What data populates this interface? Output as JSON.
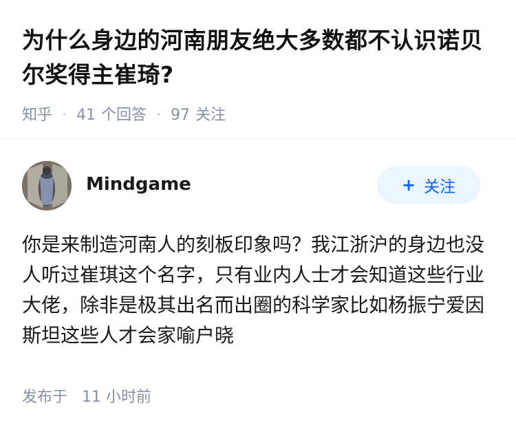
{
  "question": {
    "title": "为什么身边的河南朋友绝大多数都不认识诺贝尔奖得主崔琦?",
    "source": "知乎",
    "answer_count": "41",
    "answer_label": "个回答",
    "follow_count": "97",
    "follow_label": "关注"
  },
  "answer": {
    "author_name": "Mindgame",
    "follow_button_label": "关注",
    "content": "你是来制造河南人的刻板印象吗？我江浙沪的身边也没人听过崔琪这个名字，只有业内人士才会知道这些行业大佬，除非是极其出名而出圈的科学家比如杨振宁爱因斯坦这些人才会家喻户晓",
    "publish_label": "发布于",
    "publish_time": "11 小时前"
  },
  "icons": {
    "follow_plus": "plus-icon",
    "avatar": "avatar-photo"
  },
  "colors": {
    "meta_text": "#8590a6",
    "follow_bg": "#ebf5ff",
    "follow_text": "#0066ff"
  }
}
